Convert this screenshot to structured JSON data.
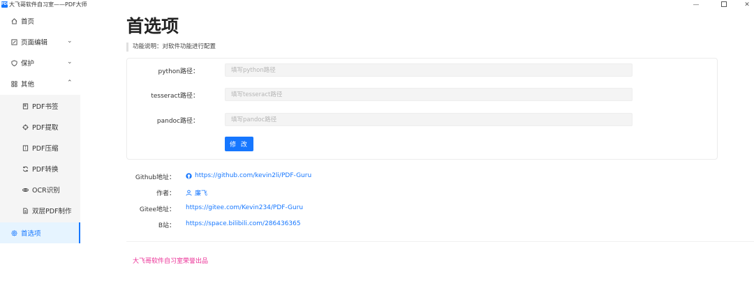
{
  "window": {
    "title": "大飞哥软件自习室——PDF大师",
    "logo_text": "PDF",
    "minimize": "—",
    "close": "✕"
  },
  "sidebar": {
    "items": [
      {
        "label": "首页",
        "icon": "home-icon"
      },
      {
        "label": "页面编辑",
        "icon": "edit-icon",
        "caret": "⌄"
      },
      {
        "label": "保护",
        "icon": "shield-icon",
        "caret": "⌄"
      },
      {
        "label": "其他",
        "icon": "apps-icon",
        "caret": "⌃"
      }
    ],
    "sub_items": [
      {
        "label": "PDF书签",
        "icon": "book-icon"
      },
      {
        "label": "PDF提取",
        "icon": "aim-icon"
      },
      {
        "label": "PDF压缩",
        "icon": "compress-icon"
      },
      {
        "label": "PDF转换",
        "icon": "sync-icon"
      },
      {
        "label": "OCR识别",
        "icon": "eye-icon"
      },
      {
        "label": "双层PDF制作",
        "icon": "file-icon"
      }
    ],
    "active": {
      "label": "首选项",
      "icon": "gear-icon"
    }
  },
  "main": {
    "title": "首选项",
    "description": "功能说明：对软件功能进行配置",
    "form": {
      "python_label": "python路径：",
      "python_placeholder": "填写python路径",
      "tesseract_label": "tesseract路径：",
      "tesseract_placeholder": "填写tesseract路径",
      "pandoc_label": "pandoc路径：",
      "pandoc_placeholder": "填写pandoc路径",
      "submit": "修 改"
    },
    "info": {
      "github_label": "Github地址：",
      "github_url": "https://github.com/kevin2li/PDF-Guru",
      "author_label": "作者：",
      "author_name": "廉飞",
      "gitee_label": "Gitee地址：",
      "gitee_url": "https://gitee.com/Kevin234/PDF-Guru",
      "bilibili_label": "B站：",
      "bilibili_url": "https://space.bilibili.com/286436365"
    },
    "footer": "大飞哥软件自习室荣誉出品"
  },
  "colors": {
    "accent": "#1677ff",
    "active_bg": "#e6f4ff",
    "footer": "#eb2f96"
  }
}
